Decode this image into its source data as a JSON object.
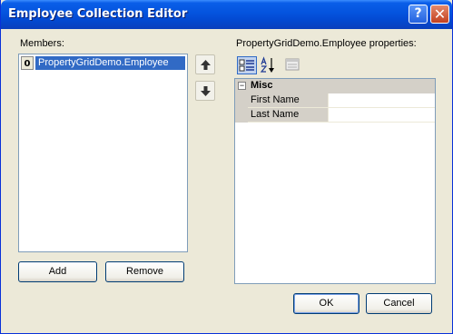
{
  "window": {
    "title": "Employee Collection Editor",
    "help_glyph": "?",
    "close_glyph": "✕"
  },
  "members": {
    "label": "Members:",
    "items": [
      {
        "index": "0",
        "text": "PropertyGridDemo.Employee",
        "selected": true
      }
    ]
  },
  "properties": {
    "label": "PropertyGridDemo.Employee properties:",
    "category": {
      "toggle": "−",
      "name": "Misc"
    },
    "rows": [
      {
        "name": "First Name",
        "value": ""
      },
      {
        "name": "Last Name",
        "value": ""
      }
    ]
  },
  "buttons": {
    "add": "Add",
    "remove": "Remove",
    "ok": "OK",
    "cancel": "Cancel"
  },
  "colors": {
    "title_bar": "#0453de",
    "selection": "#316ac5",
    "dialog_bg": "#ece9d8"
  }
}
